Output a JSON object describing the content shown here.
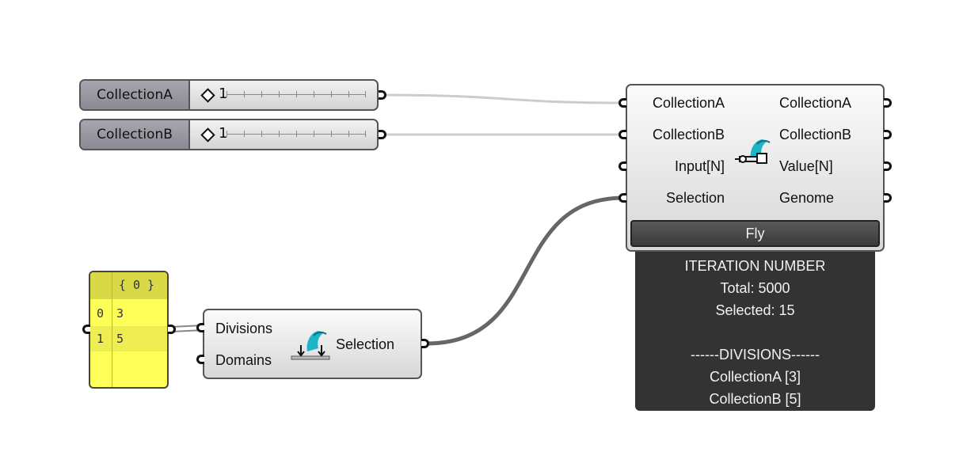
{
  "sliders": [
    {
      "label": "CollectionA",
      "value": "1"
    },
    {
      "label": "CollectionB",
      "value": "1"
    }
  ],
  "fly_component": {
    "inputs": [
      "CollectionA",
      "CollectionB",
      "Input[N]",
      "Selection"
    ],
    "outputs": [
      "CollectionA",
      "CollectionB",
      "Value[N]",
      "Genome"
    ],
    "button_label": "Fly",
    "icon": "fly-wizard-icon"
  },
  "info_panel": {
    "lines": [
      "ITERATION NUMBER",
      "Total: 5000",
      "Selected: 15",
      "",
      "------DIVISIONS------",
      "CollectionA [3]",
      "CollectionB [5]"
    ]
  },
  "panel": {
    "path": "{ 0 }",
    "rows": [
      {
        "index": "0",
        "value": "3"
      },
      {
        "index": "1",
        "value": "5"
      }
    ]
  },
  "selection_component": {
    "inputs": [
      "Divisions",
      "Domains"
    ],
    "output": "Selection",
    "icon": "selection-wizard-icon"
  },
  "colors": {
    "panel_yellow": "#ffff59",
    "info_background": "#333333",
    "wire_light": "#cccccc",
    "wire_dark": "#666666"
  }
}
